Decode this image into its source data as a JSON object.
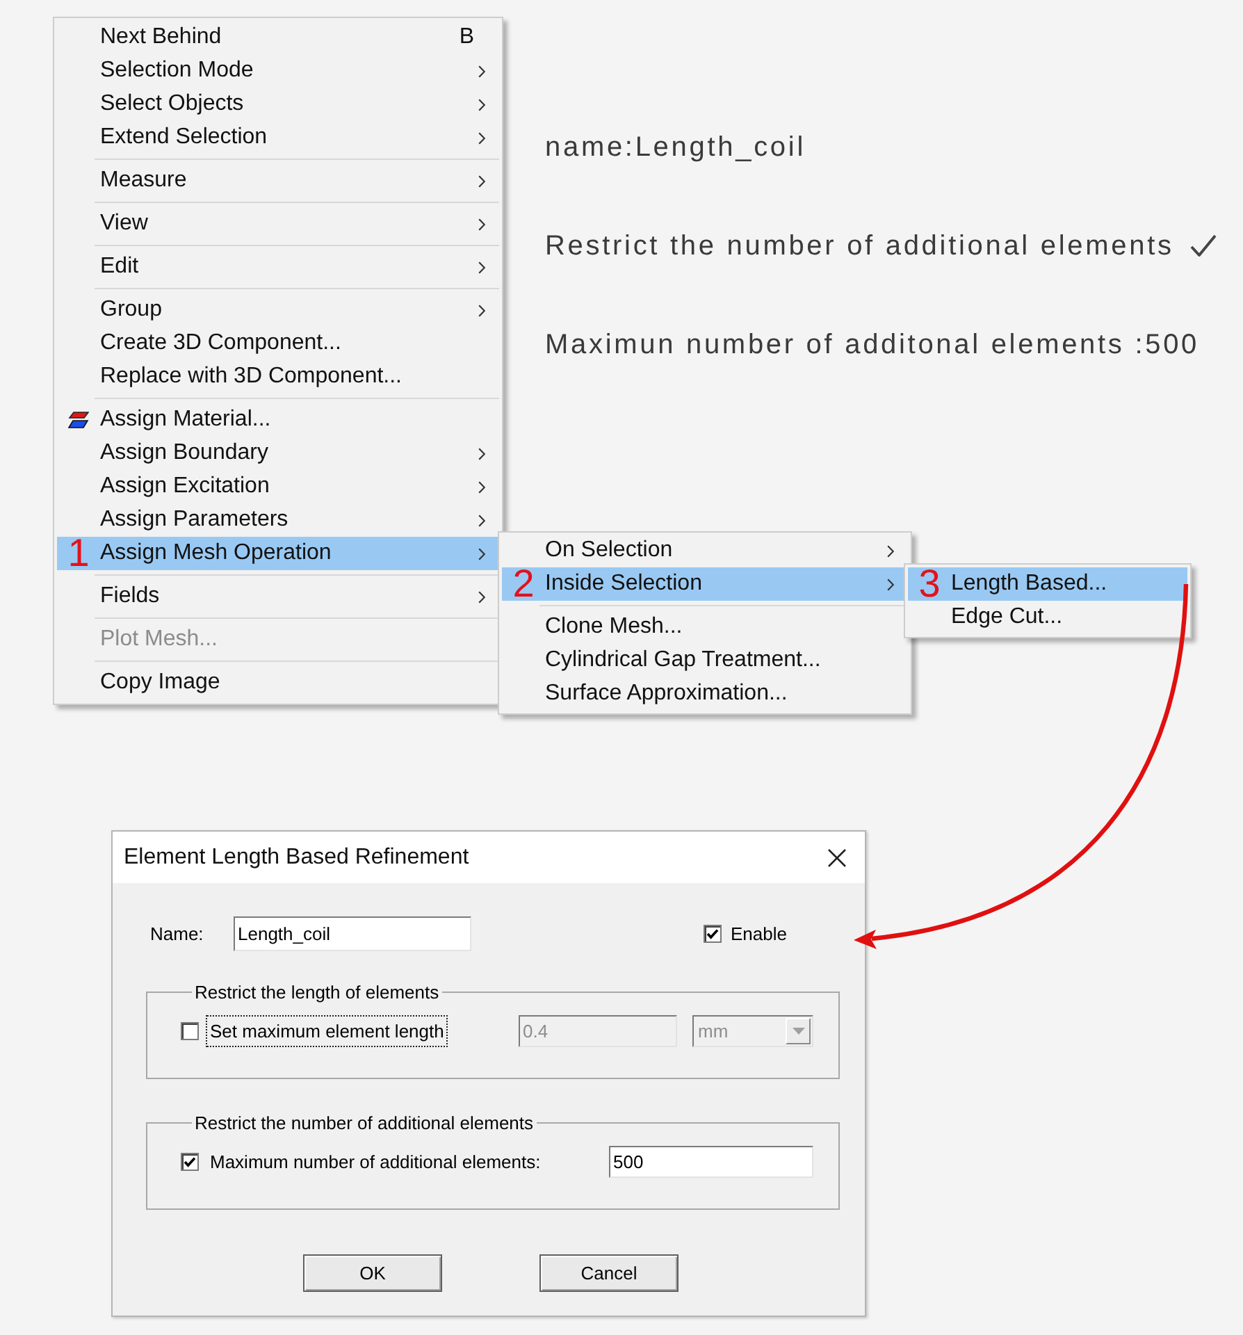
{
  "context_menu": {
    "items": [
      {
        "kind": "item",
        "label": "Next Behind",
        "shortcut": "B",
        "has_submenu": false,
        "selected": false,
        "disabled": false
      },
      {
        "kind": "item",
        "label": "Selection Mode",
        "has_submenu": true,
        "selected": false,
        "disabled": false
      },
      {
        "kind": "item",
        "label": "Select Objects",
        "has_submenu": true,
        "selected": false,
        "disabled": false
      },
      {
        "kind": "item",
        "label": "Extend Selection",
        "has_submenu": true,
        "selected": false,
        "disabled": false
      },
      {
        "kind": "separator"
      },
      {
        "kind": "item",
        "label": "Measure",
        "has_submenu": true,
        "selected": false,
        "disabled": false
      },
      {
        "kind": "separator"
      },
      {
        "kind": "item",
        "label": "View",
        "has_submenu": true,
        "selected": false,
        "disabled": false
      },
      {
        "kind": "separator"
      },
      {
        "kind": "item",
        "label": "Edit",
        "has_submenu": true,
        "selected": false,
        "disabled": false
      },
      {
        "kind": "separator"
      },
      {
        "kind": "item",
        "label": "Group",
        "has_submenu": true,
        "selected": false,
        "disabled": false
      },
      {
        "kind": "item",
        "label": "Create 3D Component...",
        "has_submenu": false,
        "selected": false,
        "disabled": false
      },
      {
        "kind": "item",
        "label": "Replace with 3D Component...",
        "has_submenu": false,
        "selected": false,
        "disabled": false
      },
      {
        "kind": "separator"
      },
      {
        "kind": "item",
        "label": "Assign Material...",
        "icon": true,
        "has_submenu": false,
        "selected": false,
        "disabled": false
      },
      {
        "kind": "item",
        "label": "Assign Boundary",
        "has_submenu": true,
        "selected": false,
        "disabled": false
      },
      {
        "kind": "item",
        "label": "Assign Excitation",
        "has_submenu": true,
        "selected": false,
        "disabled": false
      },
      {
        "kind": "item",
        "label": "Assign Parameters",
        "has_submenu": true,
        "selected": false,
        "disabled": false
      },
      {
        "kind": "item",
        "label": "Assign Mesh Operation",
        "step": "1",
        "has_submenu": true,
        "selected": true,
        "disabled": false
      },
      {
        "kind": "separator"
      },
      {
        "kind": "item",
        "label": "Fields",
        "has_submenu": true,
        "selected": false,
        "disabled": false
      },
      {
        "kind": "separator"
      },
      {
        "kind": "item",
        "label": "Plot Mesh...",
        "has_submenu": false,
        "selected": false,
        "disabled": true
      },
      {
        "kind": "separator"
      },
      {
        "kind": "item",
        "label": "Copy Image",
        "has_submenu": false,
        "selected": false,
        "disabled": false
      }
    ]
  },
  "submenu_level_2": {
    "items": [
      {
        "kind": "item",
        "label": "On Selection",
        "has_submenu": true,
        "selected": false,
        "disabled": false
      },
      {
        "kind": "item",
        "label": "Inside Selection",
        "step": "2",
        "has_submenu": true,
        "selected": true,
        "disabled": false
      },
      {
        "kind": "separator"
      },
      {
        "kind": "item",
        "label": "Clone Mesh...",
        "has_submenu": false,
        "selected": false,
        "disabled": false
      },
      {
        "kind": "item",
        "label": "Cylindrical Gap Treatment...",
        "has_submenu": false,
        "selected": false,
        "disabled": false
      },
      {
        "kind": "item",
        "label": "Surface Approximation...",
        "has_submenu": false,
        "selected": false,
        "disabled": false
      }
    ]
  },
  "submenu_level_3": {
    "items": [
      {
        "kind": "item",
        "label": "Length Based...",
        "step": "3",
        "has_submenu": false,
        "selected": true,
        "disabled": false
      },
      {
        "kind": "item",
        "label": "Edge Cut...",
        "has_submenu": false,
        "selected": false,
        "disabled": false
      }
    ]
  },
  "annotations": [
    {
      "text": "name:Length_coil",
      "checked": false
    },
    {
      "text": "Restrict the number of additional elements",
      "checked": true
    },
    {
      "text": "Maximun number of additonal elements :500",
      "checked": false
    }
  ],
  "dialog": {
    "title": "Element Length Based Refinement",
    "name_label": "Name:",
    "name_value": "Length_coil",
    "enable": {
      "label": "Enable",
      "checked": true
    },
    "groups": [
      {
        "legend": "Restrict the length of elements",
        "option": {
          "label": "Set maximum element length",
          "checked": false,
          "focused": true
        },
        "value": "0.4",
        "disabled": true,
        "unit": "mm"
      },
      {
        "legend": "Restrict the number of additional elements",
        "option": {
          "label": "Maximum number of additional elements:",
          "checked": true,
          "focused": false
        },
        "value": "500",
        "disabled": false
      }
    ],
    "buttons": [
      "OK",
      "Cancel"
    ]
  }
}
